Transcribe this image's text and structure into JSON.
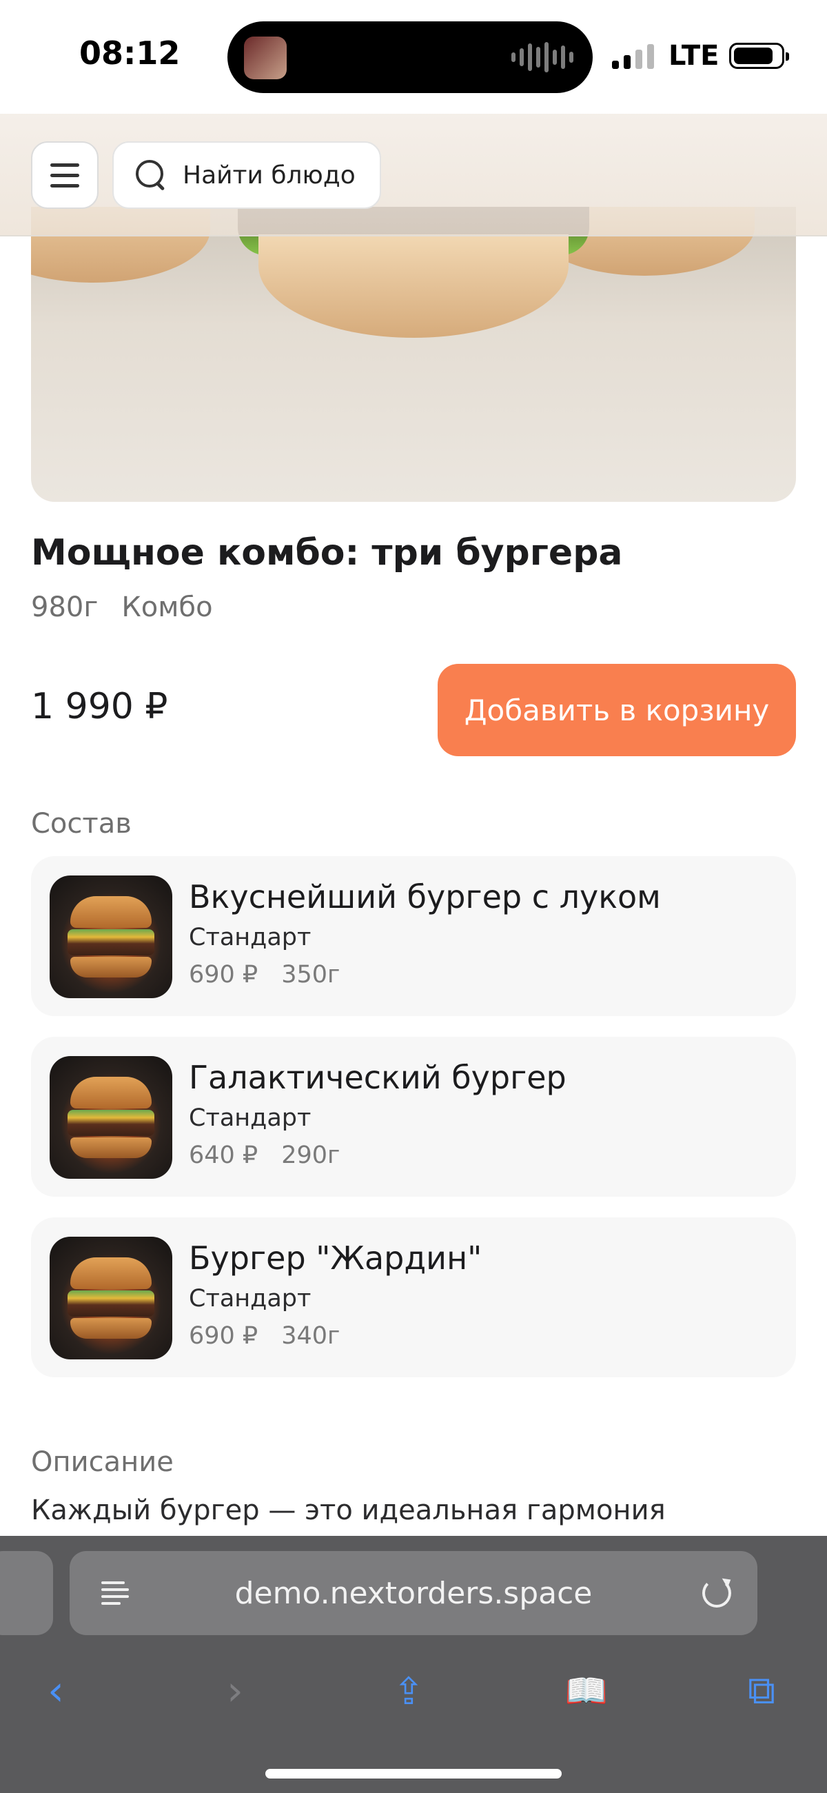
{
  "status_bar": {
    "time": "08:12",
    "network": "LTE"
  },
  "header": {
    "search_placeholder": "Найти блюдо"
  },
  "product": {
    "title": "Мощное комбо: три бургера",
    "weight": "980г",
    "category": "Комбо",
    "price": "1 990 ₽",
    "add_to_cart_label": "Добавить в корзину"
  },
  "composition": {
    "heading": "Состав",
    "items": [
      {
        "name": "Вкуснейший бургер с луком",
        "variant": "Стандарт",
        "price": "690 ₽",
        "weight": "350г"
      },
      {
        "name": "Галактический бургер",
        "variant": "Стандарт",
        "price": "640 ₽",
        "weight": "290г"
      },
      {
        "name": "Бургер \"Жардин\"",
        "variant": "Стандарт",
        "price": "690 ₽",
        "weight": "340г"
      }
    ]
  },
  "description": {
    "heading": "Описание",
    "text": "Каждый бургер — это идеальная гармония"
  },
  "browser": {
    "url": "demo.nextorders.space",
    "toolbar": {
      "back": "‹",
      "forward": "›",
      "share": "⇪",
      "bookmarks": "📖",
      "tabs": "⧉"
    }
  },
  "colors": {
    "accent": "#f97f4f",
    "toolbar_icon": "#4a90f5"
  }
}
